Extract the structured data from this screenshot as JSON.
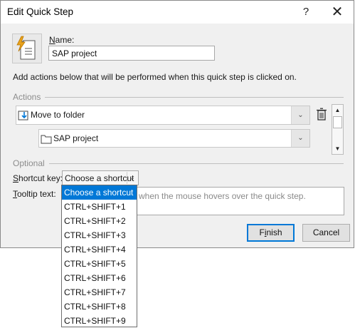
{
  "window": {
    "title": "Edit Quick Step",
    "help_label": "?",
    "close_label": "✕"
  },
  "name": {
    "label_accel": "N",
    "label_rest": "ame:",
    "value": "SAP project"
  },
  "description": "Add actions below that will be performed when this quick step is clicked on.",
  "actions": {
    "section_label": "Actions",
    "action_value": "Move to folder",
    "folder_value": "SAP project"
  },
  "optional": {
    "section_label": "Optional",
    "shortcut_label_accel": "S",
    "shortcut_label_rest": "hortcut key:",
    "shortcut_value": "Choose a shortcut",
    "tooltip_label_accel": "T",
    "tooltip_label_rest": "ooltip text:",
    "tooltip_placeholder": "when the mouse hovers over the quick step."
  },
  "buttons": {
    "finish_accel": "i",
    "finish_pre": "F",
    "finish_rest": "nish",
    "cancel": "Cancel"
  },
  "dropdown": {
    "options": [
      "Choose a shortcut",
      "CTRL+SHIFT+1",
      "CTRL+SHIFT+2",
      "CTRL+SHIFT+3",
      "CTRL+SHIFT+4",
      "CTRL+SHIFT+5",
      "CTRL+SHIFT+6",
      "CTRL+SHIFT+7",
      "CTRL+SHIFT+8",
      "CTRL+SHIFT+9"
    ],
    "selected_index": 0
  },
  "colors": {
    "accent": "#0078d7",
    "icon_lightning": "#e8a21c"
  }
}
